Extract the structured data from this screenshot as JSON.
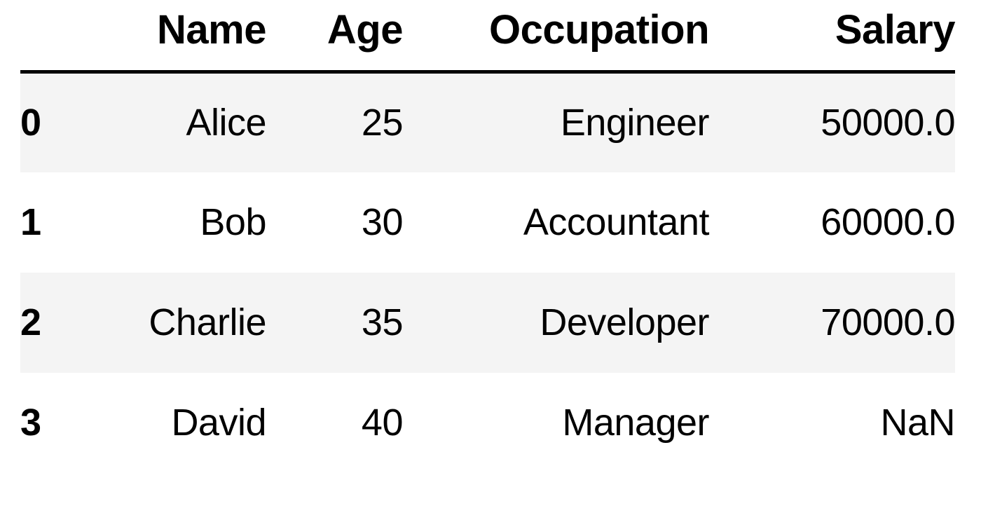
{
  "table": {
    "index_header": "",
    "columns": [
      "Name",
      "Age",
      "Occupation",
      "Salary"
    ],
    "index": [
      "0",
      "1",
      "2",
      "3"
    ],
    "rows": [
      {
        "index": "0",
        "name": "Alice",
        "age": "25",
        "occupation": "Engineer",
        "salary": "50000.0"
      },
      {
        "index": "1",
        "name": "Bob",
        "age": "30",
        "occupation": "Accountant",
        "salary": "60000.0"
      },
      {
        "index": "2",
        "name": "Charlie",
        "age": "35",
        "occupation": "Developer",
        "salary": "70000.0"
      },
      {
        "index": "3",
        "name": "David",
        "age": "40",
        "occupation": "Manager",
        "salary": "NaN"
      }
    ],
    "style": {
      "stripe_color": "#f4f4f4",
      "plain_color": "#ffffff",
      "text_color": "#000000",
      "header_rule_color": "#000000",
      "page_background": "#ffffff"
    }
  }
}
